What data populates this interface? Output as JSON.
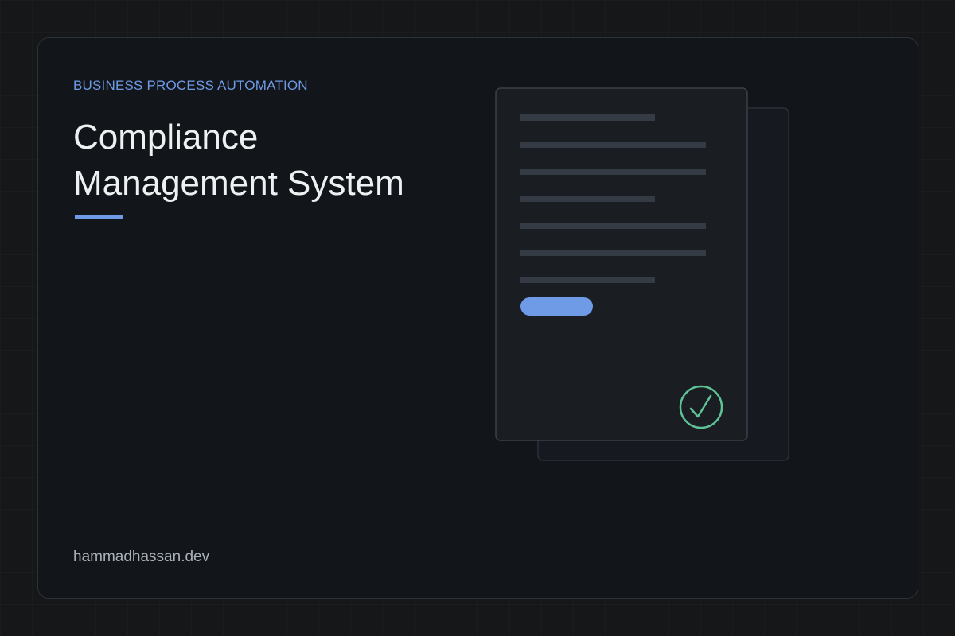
{
  "header": {
    "eyebrow": "BUSINESS PROCESS AUTOMATION",
    "title_lines": [
      "Compliance",
      "Management System"
    ]
  },
  "footer": {
    "domain": "hammadhassan.dev"
  },
  "illustration": {
    "icons": [
      "document-icon",
      "check-circle-icon"
    ]
  },
  "colors": {
    "background": "#151719",
    "card": "#12161a",
    "accent": "#6f9ae6",
    "title_text": "#eef0f2",
    "muted_text": "#aab0b7",
    "check": "#5fc495",
    "document_line": "#343b44"
  }
}
